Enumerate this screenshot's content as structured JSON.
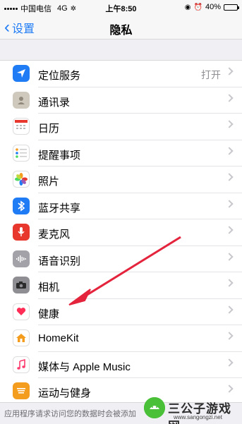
{
  "status_bar": {
    "carrier": "中国电信",
    "network": "4G",
    "time": "上午8:50",
    "battery": "40%",
    "battery_level": 0.4
  },
  "nav": {
    "back_label": "设置",
    "title": "隐私"
  },
  "items": [
    {
      "label": "定位服务",
      "value": "打开",
      "icon": "location-arrow-icon",
      "color": "#1f7cf5"
    },
    {
      "label": "通讯录",
      "icon": "contacts-icon",
      "color": "#b9b3a8"
    },
    {
      "label": "日历",
      "icon": "calendar-icon",
      "color": "#ffffff"
    },
    {
      "label": "提醒事项",
      "icon": "reminders-icon",
      "color": "#ffffff"
    },
    {
      "label": "照片",
      "icon": "photos-icon",
      "color": "#ffffff"
    },
    {
      "label": "蓝牙共享",
      "icon": "bluetooth-icon",
      "color": "#1f7cf5"
    },
    {
      "label": "麦克风",
      "icon": "microphone-icon",
      "color": "#e8372c"
    },
    {
      "label": "语音识别",
      "icon": "waveform-icon",
      "color": "#9a9aa1"
    },
    {
      "label": "相机",
      "icon": "camera-icon",
      "color": "#8e8e93"
    },
    {
      "label": "健康",
      "icon": "heart-icon",
      "color": "#ffffff"
    },
    {
      "label": "HomeKit",
      "icon": "home-icon",
      "color": "#ffffff"
    },
    {
      "label": "媒体与 Apple Music",
      "icon": "music-note-icon",
      "color": "#ffffff"
    },
    {
      "label": "运动与健身",
      "icon": "fitness-icon",
      "color": "#f39c1e"
    }
  ],
  "footer": {
    "text": "应用程序请求访问您的数据时会被添加"
  },
  "watermark": {
    "title": "三公子游戏网",
    "url": "www.sangongzi.net"
  }
}
